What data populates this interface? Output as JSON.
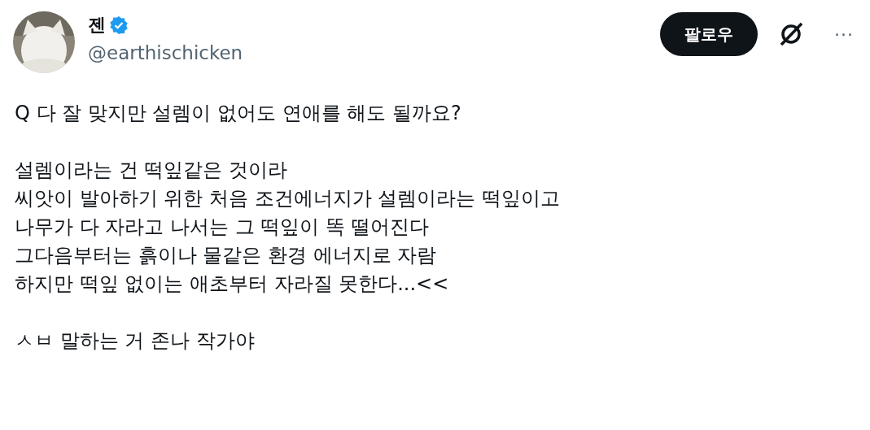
{
  "author": {
    "name": "젠",
    "verified": true,
    "handle": "@earthischicken"
  },
  "follow_button": "팔로우",
  "more_button": "···",
  "paragraphs": [
    [
      "Q 다 잘 맞지만 설렘이 없어도 연애를 해도 될까요?"
    ],
    [
      "설렘이라는 건 떡잎같은 것이라",
      "씨앗이 발아하기 위한 처음 조건에너지가 설렘이라는 떡잎이고",
      "나무가 다 자라고 나서는 그 떡잎이 똑 떨어진다",
      "그다음부터는 흙이나 물같은 환경 에너지로 자람",
      "하지만 떡잎 없이는 애초부터 자라질 못한다...<<"
    ],
    [
      "ㅅㅂ 말하는 거 존나 작가야"
    ]
  ]
}
